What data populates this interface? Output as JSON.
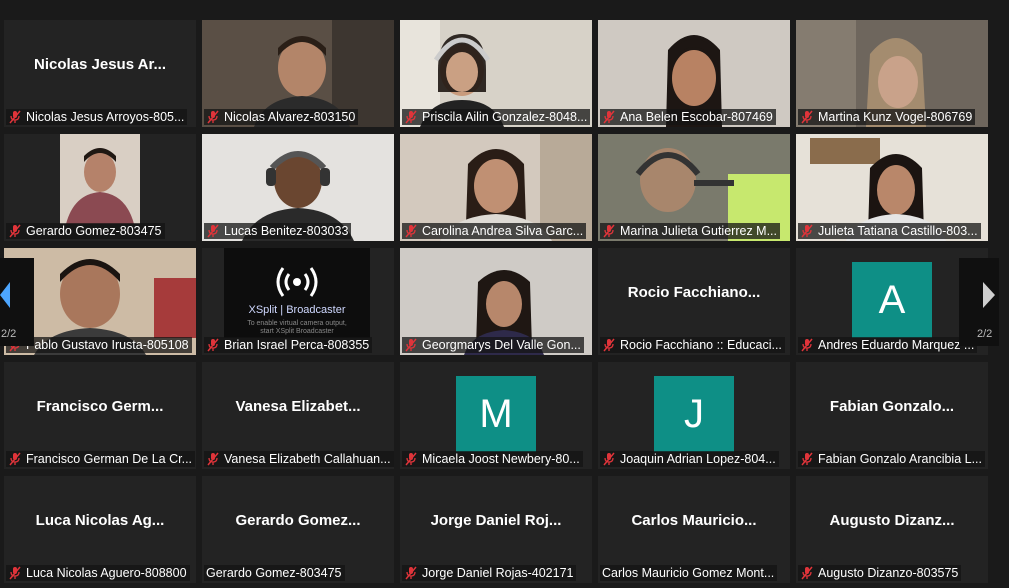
{
  "colors": {
    "avatar_bg": "#0e8f86",
    "tile_bg": "#232323",
    "muted_mic": "#e0343a"
  },
  "pagination": {
    "current_left": "2/2",
    "current_right": "2/2"
  },
  "tiles": [
    {
      "name": "Nicolas Jesus Arroyos-805...",
      "big": "Nicolas Jesus Ar..."
    },
    {
      "name": "Nicolas Alvarez-803150"
    },
    {
      "name": "Priscila Ailin Gonzalez-8048..."
    },
    {
      "name": "Ana Belen Escobar-807469"
    },
    {
      "name": "Martina Kunz Vogel-806769"
    },
    {
      "name": "Gerardo Gomez-803475"
    },
    {
      "name": "Lucas Benitez-803033"
    },
    {
      "name": "Carolina Andrea Silva Garc..."
    },
    {
      "name": "Marina Julieta Gutierrez M..."
    },
    {
      "name": "Julieta Tatiana Castillo-803..."
    },
    {
      "name": "Pablo Gustavo Irusta-805108"
    },
    {
      "name": "Brian Israel Perca-808355",
      "xsplit_title": "XSplit | Broadcaster",
      "xsplit_sub": "To enable virtual camera output, start XSplit Broadcaster"
    },
    {
      "name": "Georgmarys Del Valle Gon..."
    },
    {
      "name": "Rocio Facchiano :: Educaci...",
      "big": "Rocio  Facchiano..."
    },
    {
      "name": "Andres Eduardo Marquez ...",
      "avatar": "A"
    },
    {
      "name": "Francisco German De La Cr...",
      "big": "Francisco  Germ..."
    },
    {
      "name": "Vanesa Elizabeth Callahuan...",
      "big": "Vanesa  Elizabet..."
    },
    {
      "name": "Micaela Joost Newbery-80...",
      "avatar": "M"
    },
    {
      "name": "Joaquin Adrian Lopez-804...",
      "avatar": "J"
    },
    {
      "name": "Fabian Gonzalo Arancibia L...",
      "big": "Fabian  Gonzalo..."
    },
    {
      "name": "Luca Nicolas Aguero-808800",
      "big": "Luca Nicolas Ag..."
    },
    {
      "name": "Gerardo Gomez-803475",
      "big": "Gerardo  Gomez..."
    },
    {
      "name": "Jorge Daniel Rojas-402171",
      "big": "Jorge  Daniel  Roj..."
    },
    {
      "name": "Carlos Mauricio Gomez Mont...",
      "big": "Carlos  Mauricio..."
    },
    {
      "name": "Augusto Dizanzo-803575",
      "big": "Augusto  Dizanz..."
    }
  ]
}
